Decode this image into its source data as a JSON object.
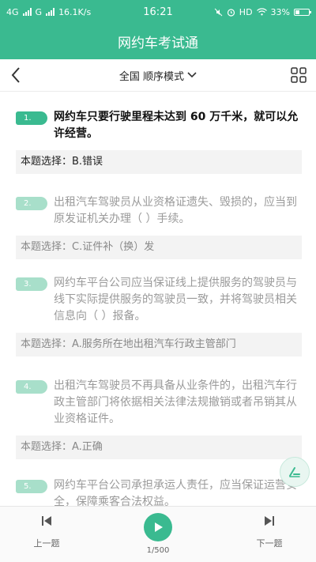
{
  "status_bar": {
    "network_label": "4G",
    "signal2_label": "G",
    "speed": "16.1K/s",
    "time": "16:21",
    "hd_label": "HD",
    "battery_percent": "33%"
  },
  "header": {
    "title": "网约车考试通"
  },
  "nav": {
    "mode_label": "全国 顺序模式"
  },
  "questions": [
    {
      "num": "1.",
      "text": "网约车只要行驶里程未达到 60 万千米，就可以允许经营。",
      "answer": "本题选择：B.错误"
    },
    {
      "num": "2.",
      "text": "出租汽车驾驶员从业资格证遗失、毁损的，应当到原发证机关办理（ ）手续。",
      "answer": "本题选择：C.证件补（换）发"
    },
    {
      "num": "3.",
      "text": "网约车平台公司应当保证线上提供服务的驾驶员与线下实际提供服务的驾驶员一致，并将驾驶员相关信息向（ ）报备。",
      "answer": "本题选择：A.服务所在地出租汽车行政主管部门"
    },
    {
      "num": "4.",
      "text": "出租汽车驾驶员不再具备从业条件的，出租汽车行政主管部门将依据相关法律法规撤销或者吊销其从业资格证件。",
      "answer": "本题选择：A.正确"
    },
    {
      "num": "5.",
      "text": "网约车平台公司承担承运人责任，应当保证运营安全，保障乘客合法权益。",
      "answer": ""
    }
  ],
  "bottom": {
    "prev_label": "上一题",
    "next_label": "下一题",
    "counter": "1/500"
  },
  "colors": {
    "brand_green": "#3aba90"
  }
}
